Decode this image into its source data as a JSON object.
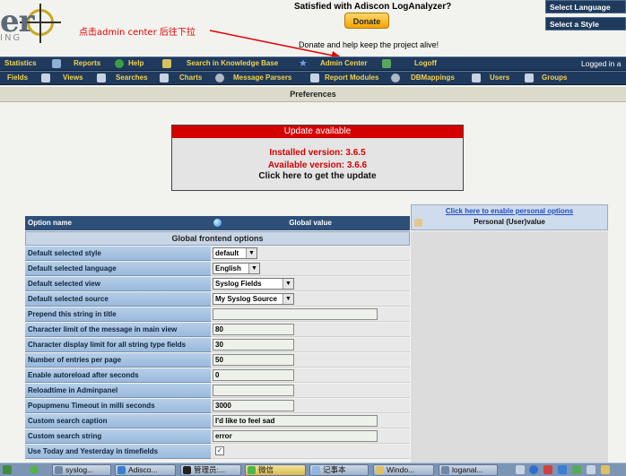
{
  "header": {
    "logo_text": "er",
    "logo_sub": "ING",
    "satisfied": "Satisfied with Adiscon LogAnalyzer?",
    "donate_button": "Donate",
    "donate_text": "Donate and help keep the project alive!",
    "annotation": "点击admin center 后往下拉",
    "select_language": "Select Language",
    "select_style": "Select a Style"
  },
  "menu1": {
    "items": [
      "Statistics",
      "Reports",
      "Help",
      "Search in Knowledge Base",
      "Admin Center",
      "Logoff"
    ],
    "logged_in": "Logged in a"
  },
  "menu2": {
    "items": [
      "Fields",
      "Views",
      "Searches",
      "Charts",
      "Message Parsers",
      "Report Modules",
      "DBMappings",
      "Users",
      "Groups"
    ]
  },
  "pref_title": "Preferences",
  "update": {
    "title": "Update available",
    "installed": "Installed version: 3.6.5",
    "available": "Available version: 3.6.6",
    "link": "Click here to get the update"
  },
  "table": {
    "col_option": "Option name",
    "col_global": "Global value",
    "enable_link": "Click here to enable personal options",
    "col_personal": "Personal (User)value",
    "section": "Global frontend options",
    "rows": [
      {
        "label": "Default selected style",
        "value": "default"
      },
      {
        "label": "Default selected language",
        "value": "English"
      },
      {
        "label": "Default selected view",
        "value": "Syslog Fields"
      },
      {
        "label": "Default selected source",
        "value": "My Syslog Source"
      },
      {
        "label": "Prepend this string in title",
        "value": ""
      },
      {
        "label": "Character limit of the message in main view",
        "value": "80"
      },
      {
        "label": "Character display limit for all string type fields",
        "value": "30"
      },
      {
        "label": "Number of entries per page",
        "value": "50"
      },
      {
        "label": "Enable autoreload after seconds",
        "value": "0"
      },
      {
        "label": "Reloadtime in Adminpanel",
        "value": ""
      },
      {
        "label": "Popupmenu Timeout in milli seconds",
        "value": "3000"
      },
      {
        "label": "Custom search caption",
        "value": "I'd like to feel sad"
      },
      {
        "label": "Custom search string",
        "value": "error"
      },
      {
        "label": "Use Today and Yesterday in timefields",
        "value": "✓"
      }
    ]
  },
  "taskbar": {
    "items": [
      "syslog...",
      "Adisco...",
      "管理员:...",
      "微信",
      "记事本",
      "Windo...",
      "loganal..."
    ]
  },
  "colors": {
    "menubar": "#1f3a5c",
    "menu_text": "#f3d250",
    "update_header": "#d40000",
    "annotation": "#e00000"
  }
}
